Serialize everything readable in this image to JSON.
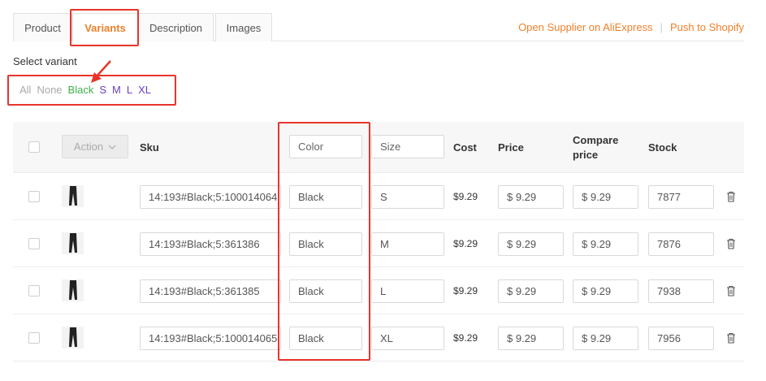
{
  "tabs": [
    {
      "label": "Product",
      "active": false
    },
    {
      "label": "Variants",
      "active": true
    },
    {
      "label": "Description",
      "active": false
    },
    {
      "label": "Images",
      "active": false
    }
  ],
  "links": {
    "supplier": "Open Supplier on AliExpress",
    "separator": "|",
    "push": "Push to Shopify"
  },
  "select_variant": {
    "label": "Select variant",
    "filters": [
      "All",
      "None",
      "Black",
      "S",
      "M",
      "L",
      "XL"
    ]
  },
  "table": {
    "action_label": "Action",
    "headers": {
      "sku": "Sku",
      "color_placeholder": "Color",
      "size_placeholder": "Size",
      "cost": "Cost",
      "price": "Price",
      "compare_price": "Compare price",
      "stock": "Stock"
    },
    "rows": [
      {
        "sku": "14:193#Black;5:100014064",
        "color": "Black",
        "size": "S",
        "cost": "$9.29",
        "price": "$ 9.29",
        "compare": "$ 9.29",
        "stock": "7877"
      },
      {
        "sku": "14:193#Black;5:361386",
        "color": "Black",
        "size": "M",
        "cost": "$9.29",
        "price": "$ 9.29",
        "compare": "$ 9.29",
        "stock": "7876"
      },
      {
        "sku": "14:193#Black;5:361385",
        "color": "Black",
        "size": "L",
        "cost": "$9.29",
        "price": "$ 9.29",
        "compare": "$ 9.29",
        "stock": "7938"
      },
      {
        "sku": "14:193#Black;5:100014065",
        "color": "Black",
        "size": "XL",
        "cost": "$9.29",
        "price": "$ 9.29",
        "compare": "$ 9.29",
        "stock": "7956"
      }
    ]
  },
  "icons": {
    "chevron": "chevron-down-icon",
    "trash": "trash-icon",
    "thumbnail": "leggings-thumbnail"
  },
  "colors": {
    "accent": "#f07f2a",
    "highlight": "#e8342b",
    "black_filter": "#3cb34a",
    "size_filter": "#6a3fc4"
  }
}
